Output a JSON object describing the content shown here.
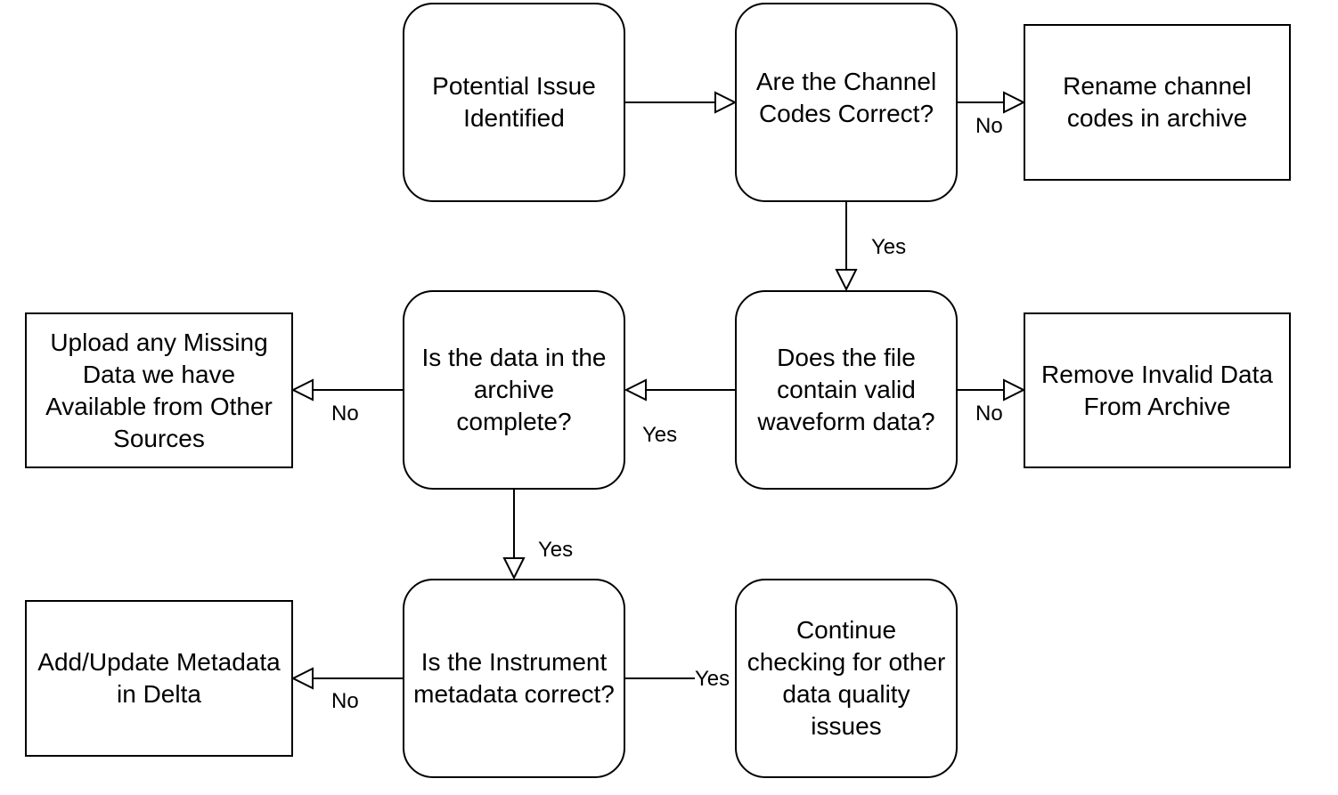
{
  "nodes": {
    "potential_issue": "Potential Issue\nIdentified",
    "channel_codes": "Are the Channel\nCodes Correct?",
    "rename_channel": "Rename channel\ncodes in archive",
    "valid_waveform": "Does the file\ncontain valid\nwaveform data?",
    "remove_invalid": "Remove Invalid Data\nFrom Archive",
    "archive_complete": "Is the data in the\narchive\ncomplete?",
    "upload_missing": "Upload any Missing\nData we have\nAvailable from Other\nSources",
    "instrument_metadata": "Is the Instrument\nmetadata correct?",
    "add_metadata": "Add/Update Metadata\nin Delta",
    "continue_checking": "Continue\nchecking for other\ndata quality\nissues"
  },
  "edges": {
    "channel_no": "No",
    "channel_yes": "Yes",
    "waveform_no": "No",
    "waveform_yes": "Yes",
    "complete_no": "No",
    "complete_yes": "Yes",
    "metadata_no": "No",
    "metadata_yes": "Yes"
  }
}
